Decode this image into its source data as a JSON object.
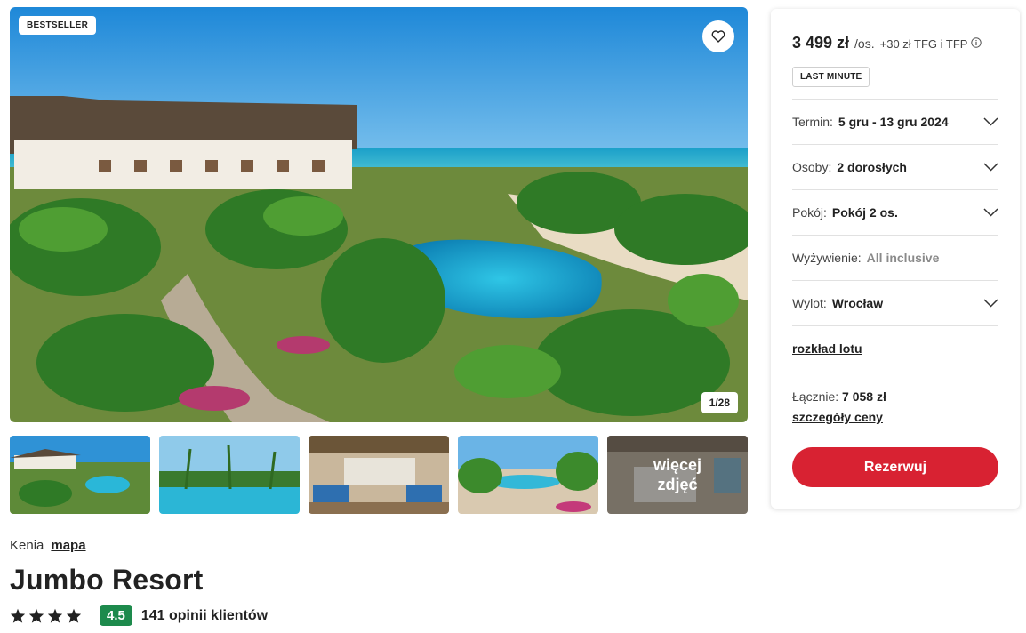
{
  "gallery": {
    "badge": "BESTSELLER",
    "counter": "1/28",
    "more_photos": "więcej zdjęć"
  },
  "booking": {
    "price": "3 499 zł",
    "per_person": "/os.",
    "fees": "+30 zł TFG i TFP",
    "tag": "LAST MINUTE",
    "options": [
      {
        "label": "Termin:",
        "value": "5 gru - 13 gru 2024"
      },
      {
        "label": "Osoby:",
        "value": "2 dorosłych"
      },
      {
        "label": "Pokój:",
        "value": "Pokój 2 os."
      },
      {
        "label": "Wyżywienie:",
        "value": "All inclusive"
      },
      {
        "label": "Wylot:",
        "value": "Wrocław"
      }
    ],
    "flight_schedule": "rozkład lotu",
    "total_label": "Łącznie:",
    "total_value": "7 058 zł",
    "price_details": "szczegóły ceny",
    "reserve": "Rezerwuj",
    "accent_color": "#d82232"
  },
  "hotel": {
    "country": "Kenia",
    "map_link": "mapa",
    "name": "Jumbo Resort",
    "stars": 4,
    "score": "4.5",
    "reviews": "141 opinii klientów",
    "score_color": "#1d8a4c"
  }
}
